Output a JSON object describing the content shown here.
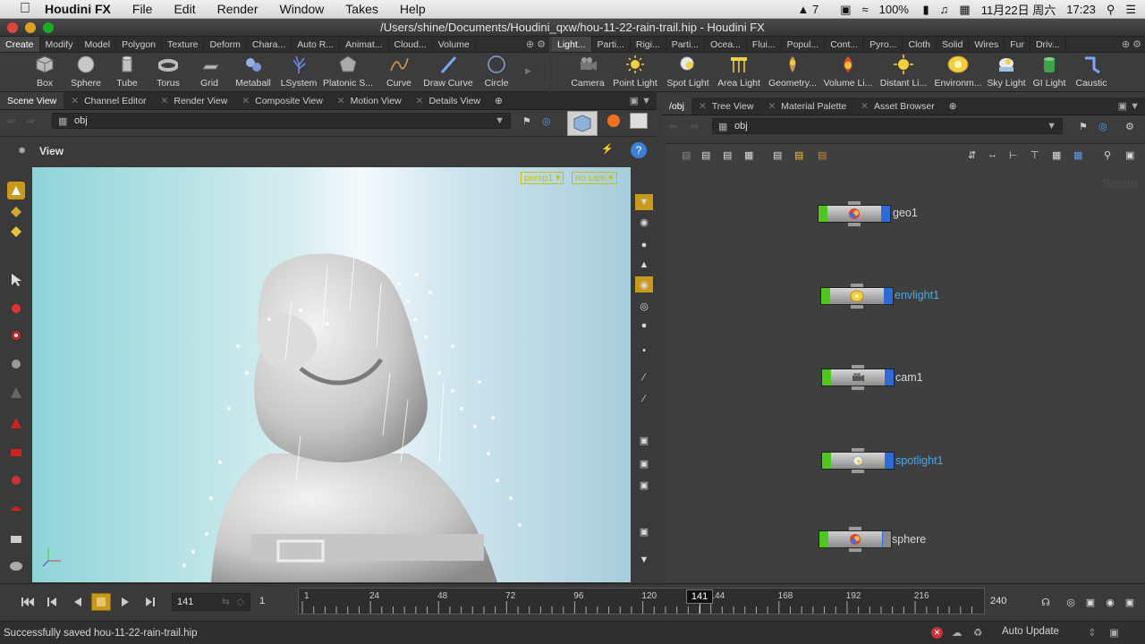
{
  "menubar": {
    "app_name": "Houdini FX",
    "items": [
      "File",
      "Edit",
      "Render",
      "Window",
      "Takes",
      "Help"
    ],
    "status": {
      "notification_count": "7",
      "battery": "100%",
      "date": "11月22日 周六",
      "time": "17:23"
    }
  },
  "window": {
    "title": "/Users/shine/Documents/Houdini_qxw/hou-11-22-rain-trail.hip - Houdini FX"
  },
  "shelf_left": {
    "tabs": [
      "Create",
      "Modify",
      "Model",
      "Polygon",
      "Texture",
      "Deform",
      "Chara...",
      "Auto R...",
      "Animat...",
      "Cloud...",
      "Volume"
    ],
    "tools": [
      {
        "label": "Box",
        "icon": "box-icon"
      },
      {
        "label": "Sphere",
        "icon": "sphere-icon"
      },
      {
        "label": "Tube",
        "icon": "tube-icon"
      },
      {
        "label": "Torus",
        "icon": "torus-icon"
      },
      {
        "label": "Grid",
        "icon": "grid-icon"
      },
      {
        "label": "Metaball",
        "icon": "metaball-icon"
      },
      {
        "label": "LSystem",
        "icon": "lsystem-icon"
      },
      {
        "label": "Platonic S...",
        "icon": "platonic-icon"
      },
      {
        "label": "Curve",
        "icon": "curve-icon"
      },
      {
        "label": "Draw Curve",
        "icon": "draw-curve-icon"
      },
      {
        "label": "Circle",
        "icon": "circle-icon"
      }
    ]
  },
  "shelf_right": {
    "tabs": [
      "Light...",
      "Parti...",
      "Rigi...",
      "Parti...",
      "Ocea...",
      "Flui...",
      "Popul...",
      "Cont...",
      "Pyro...",
      "Cloth",
      "Solid",
      "Wires",
      "Fur",
      "Driv..."
    ],
    "tools": [
      {
        "label": "Camera",
        "icon": "camera-icon"
      },
      {
        "label": "Point Light",
        "icon": "point-light-icon"
      },
      {
        "label": "Spot Light",
        "icon": "spot-light-icon"
      },
      {
        "label": "Area Light",
        "icon": "area-light-icon"
      },
      {
        "label": "Geometry...",
        "icon": "geometry-light-icon"
      },
      {
        "label": "Volume Li...",
        "icon": "volume-light-icon"
      },
      {
        "label": "Distant Li...",
        "icon": "distant-light-icon"
      },
      {
        "label": "Environm...",
        "icon": "environment-light-icon"
      },
      {
        "label": "Sky Light",
        "icon": "sky-light-icon"
      },
      {
        "label": "GI Light",
        "icon": "gi-light-icon"
      },
      {
        "label": "Caustic",
        "icon": "caustic-light-icon"
      }
    ]
  },
  "left_pane": {
    "tabs": [
      "Scene View",
      "Channel Editor",
      "Render View",
      "Composite View",
      "Motion View",
      "Details View"
    ],
    "path": "obj",
    "view_label": "View",
    "viewport_labels": {
      "camera": "persp1",
      "cam": "no cam"
    }
  },
  "right_pane": {
    "tabs": [
      "/obj",
      "Tree View",
      "Material Palette",
      "Asset Browser"
    ],
    "path": "obj",
    "watermark": "Scene",
    "nodes": [
      {
        "name": "geo1",
        "icon": "geometry-node-icon"
      },
      {
        "name": "envlight1",
        "icon": "envlight-node-icon"
      },
      {
        "name": "cam1",
        "icon": "camera-node-icon"
      },
      {
        "name": "spotlight1",
        "icon": "spotlight-node-icon"
      },
      {
        "name": "sphere",
        "icon": "geometry-node-icon"
      }
    ]
  },
  "timeline": {
    "current_frame": "141",
    "start_frame": "1",
    "end_frame": "240",
    "tick_labels": [
      "1",
      "24",
      "48",
      "72",
      "96",
      "120",
      "144",
      "168",
      "192",
      "216"
    ],
    "playhead_label": "141"
  },
  "statusbar": {
    "message": "Successfully saved hou-11-22-rain-trail.hip",
    "update_mode": "Auto Update"
  },
  "colors": {
    "node_flag_display": "#4fc61e",
    "node_flag_render": "#2d6bd6",
    "selected_node_label": "#4aa8e8"
  }
}
